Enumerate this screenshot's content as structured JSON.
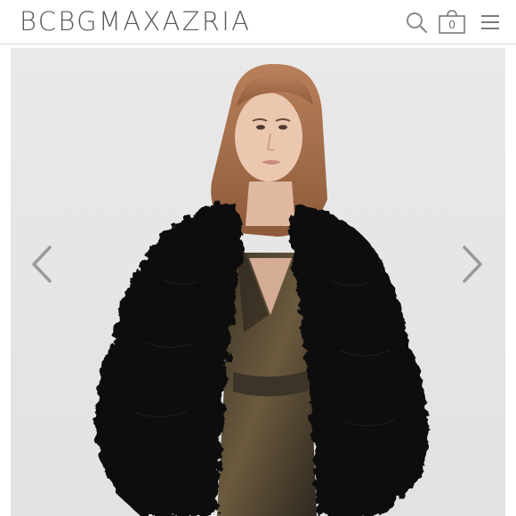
{
  "header": {
    "brand": "BCBGMAXAZRIA",
    "bag_count": "0",
    "icons": [
      "search-icon",
      "shopping-bag-icon",
      "hamburger-menu-icon"
    ]
  },
  "gallery": {
    "controls": [
      "chevron-left-icon",
      "chevron-right-icon"
    ]
  },
  "colors": {
    "brand_text": "#5a5a5a",
    "icon": "#7a7a7a",
    "gallery_background": "#e6e6e6",
    "fur": "#111111"
  }
}
